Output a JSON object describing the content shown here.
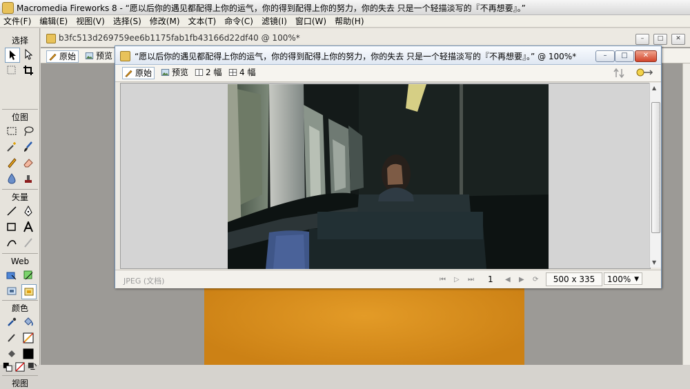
{
  "app": {
    "title": "Macromedia Fireworks 8 - “愿以后你的遇见都配得上你的运气，你的得到配得上你的努力，你的失去 只是一个轻描淡写的『不再想要』。”"
  },
  "menu": [
    "文件(F)",
    "编辑(E)",
    "视图(V)",
    "选择(S)",
    "修改(M)",
    "文本(T)",
    "命令(C)",
    "滤镜(I)",
    "窗口(W)",
    "帮助(H)"
  ],
  "tools": {
    "sections": [
      "选择",
      "位图",
      "矢量",
      "Web",
      "颜色",
      "视图"
    ]
  },
  "back_document": {
    "tab_title": "b3fc513d269759ee6b1175fab1fb43166d22df40 @ 100%*",
    "view_original": "原始",
    "view_preview": "预览"
  },
  "inner_window": {
    "title": "“愿以后你的遇见都配得上你的运气，你的得到配得上你的努力，你的失去 只是一个轻描淡写的『不再想要』。”  @ 100%*",
    "min_label": "–",
    "max_label": "□",
    "close_label": "✕",
    "view_original": "原始",
    "view_preview": "预览",
    "view_2up": "2 幅",
    "view_4up": "4 幅",
    "status": {
      "format": "JPEG (文档)",
      "frame": "1",
      "dimensions": "500 x 335",
      "zoom": "100%"
    }
  },
  "colors": {
    "accent_border": "#6f8fb3",
    "close_button": "#d2452b",
    "canvas_orange": "#e39b27"
  }
}
